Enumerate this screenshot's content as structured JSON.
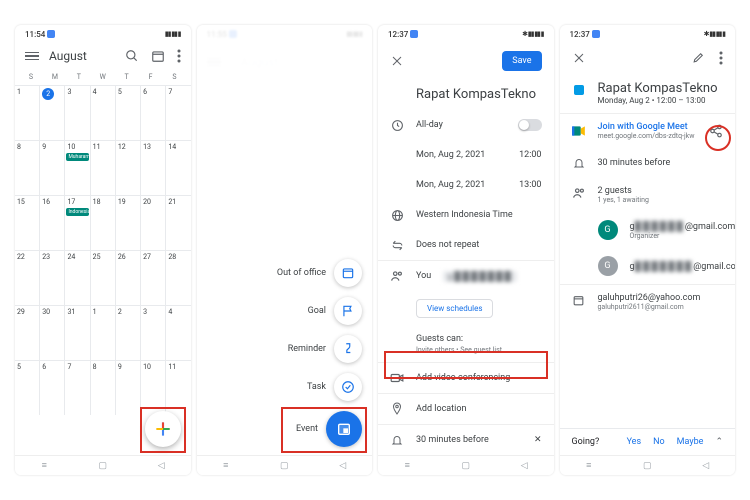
{
  "screens": {
    "0": {
      "time": "11:54",
      "month": "August",
      "status_icons": "📶 📶 🔋",
      "dow": [
        "S",
        "M",
        "T",
        "W",
        "T",
        "F",
        "S"
      ],
      "weeks": [
        [
          "1",
          "2",
          "3",
          "4",
          "5",
          "6",
          "7"
        ],
        [
          "8",
          "9",
          "10",
          "11",
          "12",
          "13",
          "14"
        ],
        [
          "15",
          "16",
          "17",
          "18",
          "19",
          "20",
          "21"
        ],
        [
          "22",
          "23",
          "24",
          "25",
          "26",
          "27",
          "28"
        ],
        [
          "29",
          "30",
          "31",
          "1",
          "2",
          "3",
          "4"
        ],
        [
          "5",
          "6",
          "7",
          "8",
          "9",
          "10",
          "11"
        ]
      ],
      "today": "2",
      "badges": {
        "10": "Muharam",
        "17": "Indonesia"
      }
    },
    "1": {
      "time": "11:55",
      "month": "August",
      "speed_dial": [
        {
          "label": "Out of office",
          "icon": "calendar"
        },
        {
          "label": "Goal",
          "icon": "flag"
        },
        {
          "label": "Reminder",
          "icon": "finger"
        },
        {
          "label": "Task",
          "icon": "check"
        },
        {
          "label": "Event",
          "icon": "event",
          "main": true
        }
      ]
    },
    "2": {
      "time": "12:37",
      "save": "Save",
      "title": "Rapat KompasTekno",
      "allday": "All-day",
      "start_date": "Mon, Aug 2, 2021",
      "start_time": "12:00",
      "end_date": "Mon, Aug 2, 2021",
      "end_time": "13:00",
      "timezone": "Western Indonesia Time",
      "repeat": "Does not repeat",
      "people_prefix": "You",
      "view_schedules": "View schedules",
      "guests_can_label": "Guests can:",
      "guests_can_sub": "Invite others • See guest list",
      "add_video": "Add video conferencing",
      "add_location": "Add location",
      "reminder": "30 minutes before"
    },
    "3": {
      "time": "12:37",
      "title": "Rapat KompasTekno",
      "subtitle": "Monday, Aug 2 • 12:00 – 13:00",
      "meet_title": "Join with Google Meet",
      "meet_url": "meet.google.com/dbs-zdtq-jkw",
      "reminder": "30 minutes before",
      "guests_count": "2 guests",
      "guests_sub": "1 yes, 1 awaiting",
      "guest1_role": "Organizer",
      "emails_label": "galuhputri26@yahoo.com",
      "emails_sub": "galuhputri2611@gmail.com",
      "going": "Going?",
      "yes": "Yes",
      "no": "No",
      "maybe": "Maybe"
    }
  }
}
